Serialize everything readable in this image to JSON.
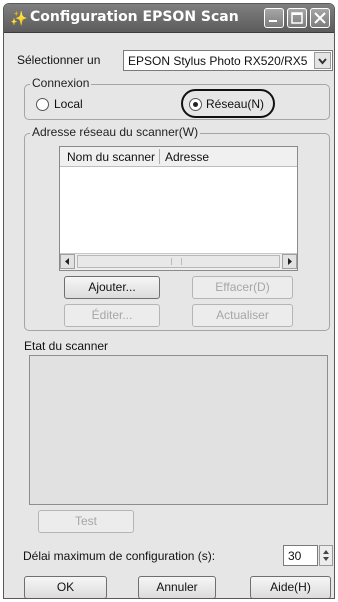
{
  "window": {
    "title": "Configuration EPSON Scan"
  },
  "scanner_select": {
    "label": "Sélectionner un",
    "value": "EPSON Stylus Photo RX520/RX5"
  },
  "connection": {
    "group_label": "Connexion",
    "local_label": "Local",
    "network_label": "Réseau(N)",
    "selected": "network"
  },
  "network_address": {
    "group_label": "Adresse réseau du scanner(W)",
    "columns": [
      "Nom du scanner",
      "Adresse"
    ],
    "rows": [],
    "add_label": "Ajouter...",
    "delete_label": "Effacer(D)",
    "edit_label": "Éditer...",
    "refresh_label": "Actualiser"
  },
  "scanner_status": {
    "label": "Etat du scanner",
    "text": ""
  },
  "test_label": "Test",
  "timeout": {
    "label": "Délai maximum de configuration (s):",
    "value": "30"
  },
  "footer": {
    "ok_label": "OK",
    "cancel_label": "Annuler",
    "help_label": "Aide(H)"
  }
}
